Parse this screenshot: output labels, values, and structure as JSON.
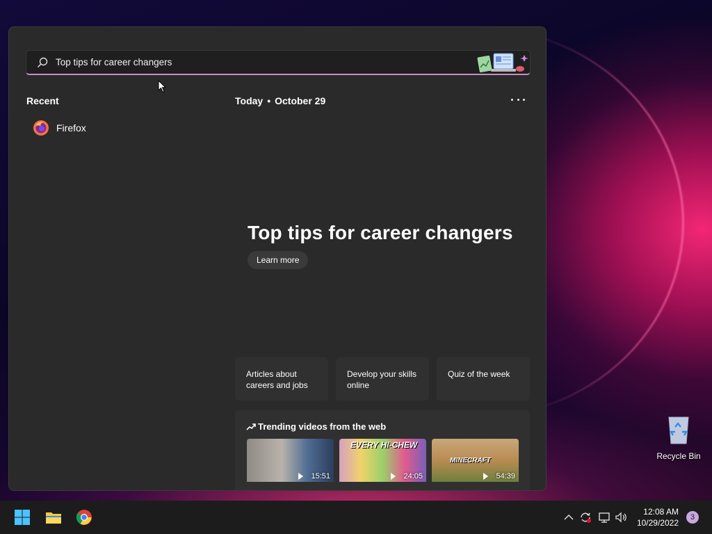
{
  "search": {
    "value": "Top tips for career changers"
  },
  "recent": {
    "title": "Recent",
    "items": [
      {
        "label": "Firefox",
        "icon": "firefox-icon"
      }
    ]
  },
  "feed": {
    "today": "Today",
    "date": "October 29",
    "hero_title": "Top tips for career changers",
    "learn_more": "Learn more",
    "tiles": [
      {
        "line1": "Articles about",
        "line2": "careers and jobs"
      },
      {
        "line1": "Develop your skills",
        "line2": "online"
      },
      {
        "line1": "Quiz of the week",
        "line2": ""
      }
    ],
    "trending": {
      "title": "Trending videos from the web",
      "videos": [
        {
          "duration": "15:51"
        },
        {
          "duration": "24:05",
          "thumb_text": "EVERY HI-CHEW"
        },
        {
          "duration": "54:39",
          "thumb_text": "MINECRAFT"
        }
      ]
    }
  },
  "desktop": {
    "recycle_bin": "Recycle Bin"
  },
  "taskbar": {
    "time": "12:08 AM",
    "date": "10/29/2022",
    "notifications": "3",
    "accent": "#c9a7e0"
  }
}
